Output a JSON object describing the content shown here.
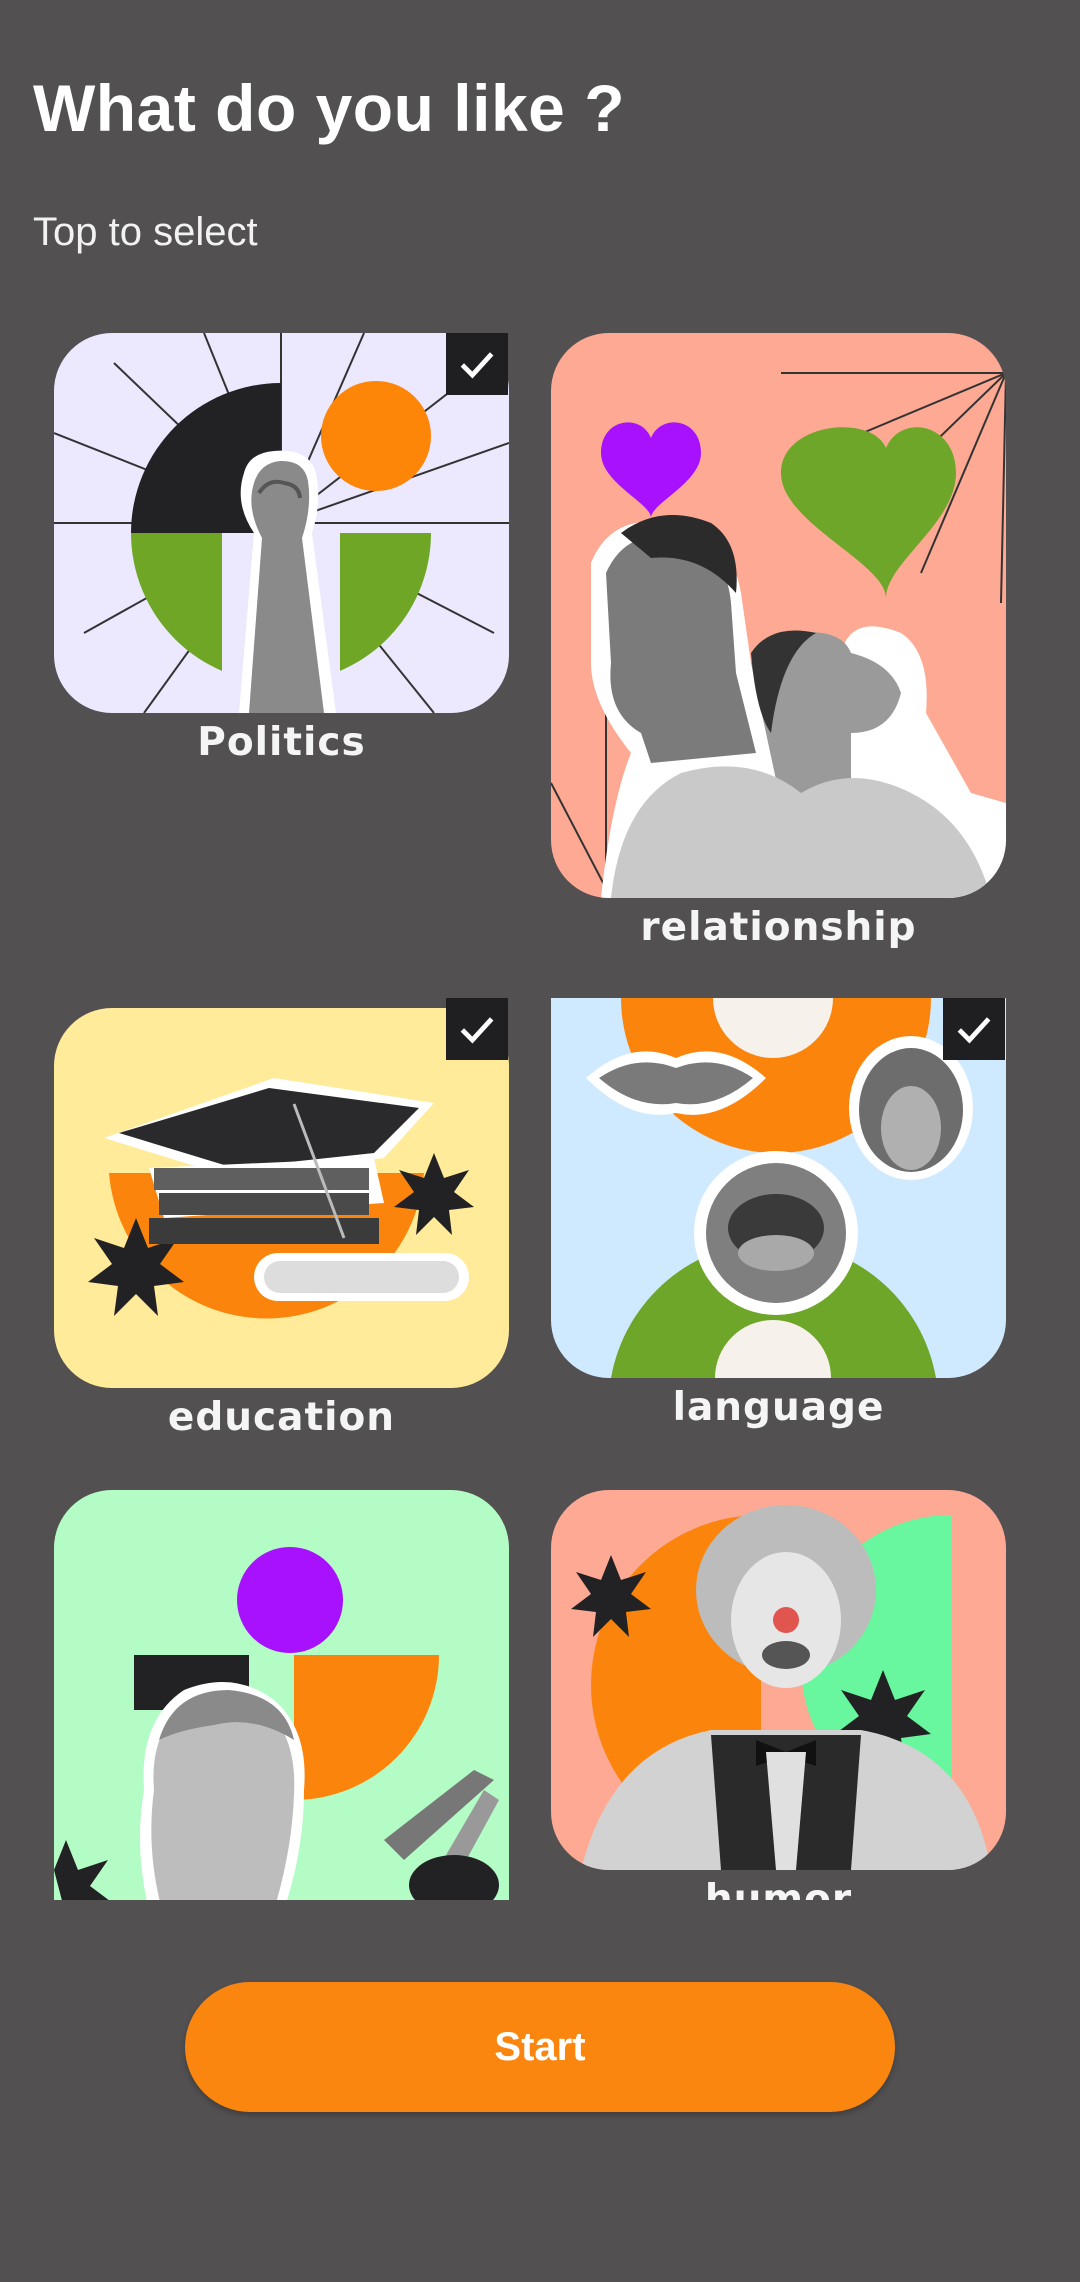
{
  "page": {
    "title": "What do you like ?",
    "subtitle": "Top to select",
    "start_label": "Start"
  },
  "colors": {
    "background": "#525051",
    "accent": "#fb860f",
    "check_bg": "#1f1e21"
  },
  "topics": [
    {
      "label": "Politics",
      "selected": true,
      "background": "#ece8fe",
      "icon": "raised-fist-icon"
    },
    {
      "label": "relationship",
      "selected": false,
      "background": "#fda993",
      "icon": "couple-hearts-icon"
    },
    {
      "label": "education",
      "selected": true,
      "background": "#ffeb9a",
      "icon": "graduation-cap-icon"
    },
    {
      "label": "language",
      "selected": true,
      "background": "#cfeaff",
      "icon": "mouths-icon"
    },
    {
      "label": "",
      "selected": false,
      "background": "#b4fcc6",
      "icon": "statue-art-icon"
    },
    {
      "label": "humor",
      "selected": false,
      "background": "#fda993",
      "icon": "clown-icon"
    }
  ]
}
